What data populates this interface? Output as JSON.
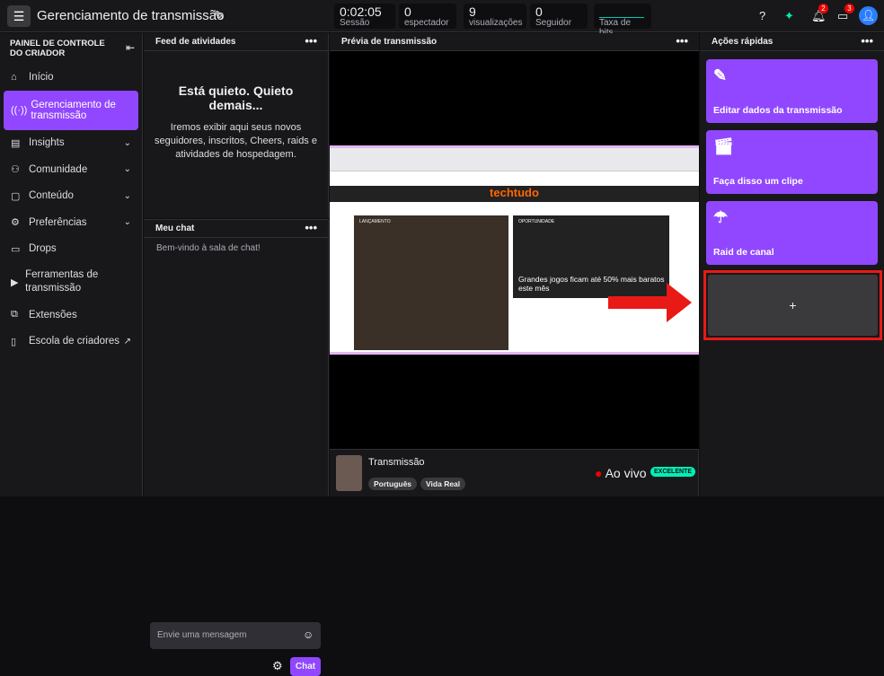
{
  "header": {
    "title": "Gerenciamento de transmissão",
    "stats": [
      {
        "value": "0:02:05",
        "label": "Sessão"
      },
      {
        "value": "0",
        "label": "espectador"
      },
      {
        "value": "9",
        "label": "visualizações"
      },
      {
        "value": "0",
        "label": "Seguidor"
      },
      {
        "value": "",
        "label": "Taxa de bits"
      }
    ],
    "notifications_count": "2",
    "whispers_count": "3"
  },
  "sidebar": {
    "title": "PAINEL DE CONTROLE DO CRIADOR",
    "items": [
      {
        "label": "Início",
        "icon": "home-icon"
      },
      {
        "label": "Gerenciamento de transmissão",
        "icon": "broadcast-icon",
        "active": true
      },
      {
        "label": "Insights",
        "icon": "chart-icon"
      },
      {
        "label": "Comunidade",
        "icon": "community-icon"
      },
      {
        "label": "Conteúdo",
        "icon": "content-icon"
      },
      {
        "label": "Preferências",
        "icon": "gear-icon"
      },
      {
        "label": "Drops",
        "icon": "drops-icon"
      },
      {
        "label": "Ferramentas de transmissão",
        "icon": "camera-icon"
      },
      {
        "label": "Extensões",
        "icon": "puzzle-icon"
      },
      {
        "label": "Escola de criadores",
        "icon": "book-icon"
      }
    ]
  },
  "activity": {
    "title": "Feed de atividades",
    "heading": "Está quieto. Quieto demais...",
    "text": "Iremos exibir aqui seus novos seguidores, inscritos, Cheers, raids e atividades de hospedagem."
  },
  "chat": {
    "title": "Meu chat",
    "welcome": "Bem-vindo à sala de chat!",
    "placeholder": "Envie uma mensagem",
    "send": "Chat"
  },
  "preview": {
    "title": "Prévia de transmissão",
    "site": "techtudo",
    "headline1": "Grandes jogos ficam até 50% mais baratos este mês",
    "label1": "LANÇAMENTO",
    "label2": "OPORTUNIDADE",
    "stream_title": "Transmissão",
    "tags": [
      "Português",
      "Vida Real"
    ],
    "status": "Ao vivo",
    "quality": "EXCELENTE"
  },
  "quick_actions": {
    "title": "Ações rápidas",
    "items": [
      "Editar dados da transmissão",
      "Faça disso um clipe",
      "Raid de canal"
    ],
    "add": "+"
  },
  "colors": {
    "accent": "#9147ff",
    "live": "#eb0400",
    "quality": "#00f0b5",
    "highlight": "#e91916"
  }
}
